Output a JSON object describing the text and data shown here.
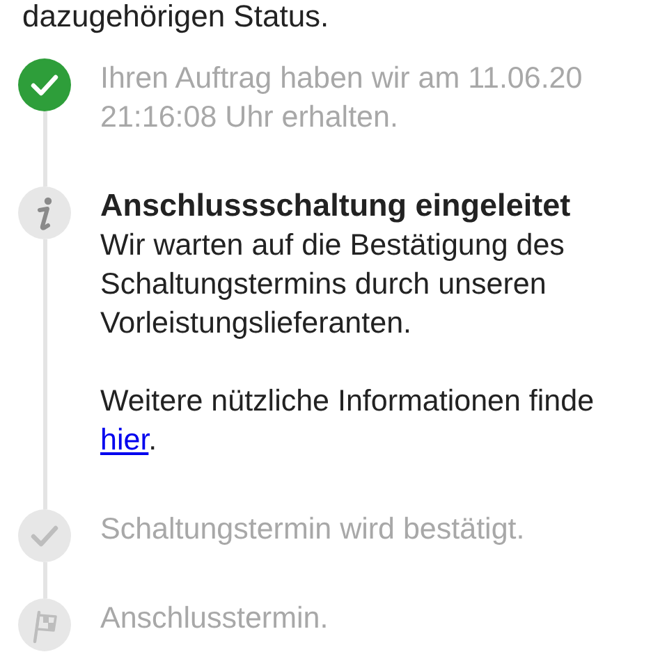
{
  "intro_fragment": "dazugehörigen Status.",
  "steps": [
    {
      "kind": "check",
      "done": true,
      "current": false,
      "lines": [
        "Ihren Auftrag haben wir am 11.06.20",
        "21:16:08 Uhr erhalten."
      ]
    },
    {
      "kind": "info",
      "done": false,
      "current": true,
      "title": "Anschlussschaltung eingeleitet",
      "body_lines": [
        "Wir warten auf die Bestätigung des",
        "Schaltungstermins durch unseren",
        "Vorleistungslieferanten."
      ],
      "note_lines": [
        "Weitere nützliche Informationen finde"
      ],
      "link": "hier",
      "note_end": "."
    },
    {
      "kind": "check",
      "done": false,
      "current": false,
      "lines": [
        "Schaltungstermin wird bestätigt."
      ]
    },
    {
      "kind": "flag",
      "done": false,
      "current": false,
      "lines": [
        "Anschlusstermin."
      ]
    }
  ]
}
